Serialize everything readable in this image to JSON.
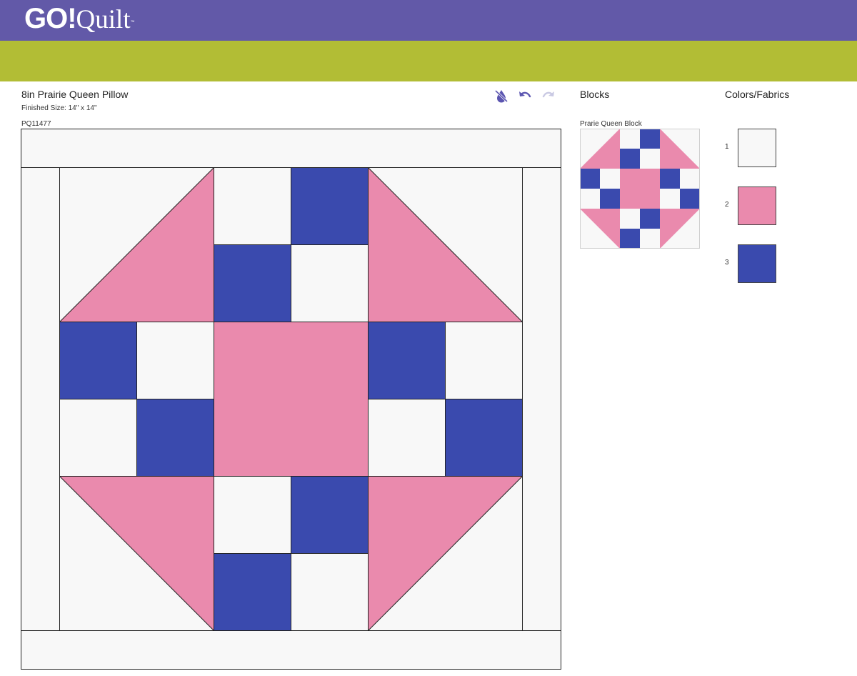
{
  "header": {
    "logo_go": "GO!",
    "logo_quilt": "Quilt",
    "logo_tm": "™"
  },
  "project": {
    "title": "8in Prairie Queen Pillow",
    "finished_size": "Finished Size: 14\" x 14\"",
    "sku": "PQ11477"
  },
  "toolbar": {
    "icons": [
      "color-fill-off-icon",
      "undo-icon",
      "redo-icon"
    ],
    "redo_enabled": false
  },
  "blocks_panel": {
    "heading": "Blocks",
    "block_name": "Prarie Queen Block"
  },
  "colors_panel": {
    "heading": "Colors/Fabrics",
    "fabrics": [
      {
        "number": "1",
        "color": "#f8f8f8"
      },
      {
        "number": "2",
        "color": "#ea8aad"
      },
      {
        "number": "3",
        "color": "#3a4aae"
      }
    ]
  },
  "colors": {
    "header_purple": "#6259a8",
    "header_green": "#b2bd35",
    "icon_active": "#5b55b0",
    "icon_disabled": "#c9c9e3"
  }
}
